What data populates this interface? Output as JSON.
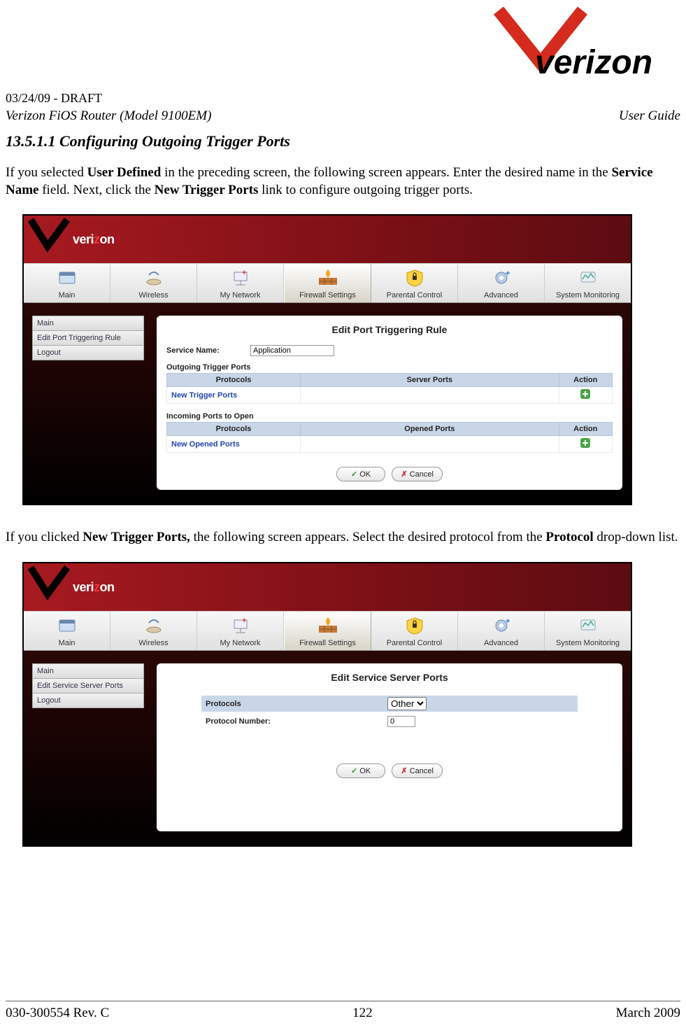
{
  "header": {
    "draft": "03/24/09 - DRAFT",
    "product": "Verizon FiOS Router (Model 9100EM)",
    "doc_type": "User Guide"
  },
  "section": {
    "number": "13.5.1.1",
    "title": "Configuring Outgoing Trigger Ports"
  },
  "paragraph1_parts": {
    "p0": "If you selected ",
    "b0": "User Defined",
    "p1": " in the preceding screen, the following screen appears. Enter the desired name in the ",
    "b1": "Service Name",
    "p2": " field. Next, click the ",
    "b2": "New Trigger Ports",
    "p3": " link to configure outgoing trigger ports."
  },
  "paragraph2_parts": {
    "p0": "If you clicked ",
    "b0": "New Trigger Ports,",
    "p1": " the following screen appears. Select the desired protocol from the ",
    "b1": "Protocol",
    "p2": " drop-down list."
  },
  "logo_text": "verizon",
  "screenshot1": {
    "nav": {
      "main": "Main",
      "wireless": "Wireless",
      "my_network": "My Network",
      "firewall": "Firewall Settings",
      "parental": "Parental Control",
      "advanced": "Advanced",
      "system": "System Monitoring"
    },
    "sidebar": {
      "main": "Main",
      "edit": "Edit Port Triggering Rule",
      "logout": "Logout"
    },
    "panel": {
      "title": "Edit Port Triggering Rule",
      "service_name_label": "Service Name:",
      "service_name_value": "Application",
      "outgoing_header": "Outgoing Trigger Ports",
      "incoming_header": "Incoming Ports to Open",
      "col_protocols": "Protocols",
      "col_server_ports": "Server Ports",
      "col_opened_ports": "Opened Ports",
      "col_action": "Action",
      "new_trigger": "New Trigger Ports",
      "new_opened": "New Opened Ports",
      "ok": "OK",
      "cancel": "Cancel"
    }
  },
  "screenshot2": {
    "sidebar": {
      "main": "Main",
      "edit": "Edit Service Server Ports",
      "logout": "Logout"
    },
    "panel": {
      "title": "Edit Service Server Ports",
      "protocols_label": "Protocols",
      "protocol_value": "Other",
      "protnum_label": "Protocol Number:",
      "protnum_value": "0",
      "ok": "OK",
      "cancel": "Cancel"
    }
  },
  "footer": {
    "left": "030-300554 Rev. C",
    "center": "122",
    "right": "March 2009"
  }
}
